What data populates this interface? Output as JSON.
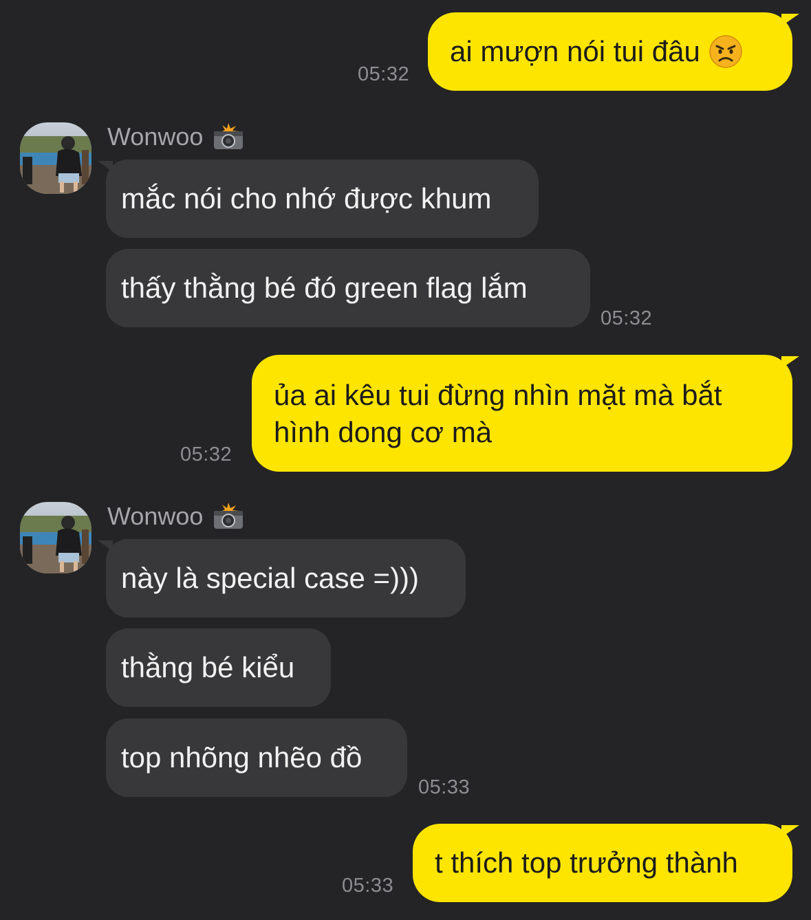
{
  "contact": {
    "name": "Wonwoo",
    "name_emoji_icon": "camera-flash-icon",
    "avatar_icon": "avatar-photo-icon"
  },
  "messages": [
    {
      "from": "me",
      "text": "ai mượn nói tui đâu",
      "emoji_icon": "angry-face-icon",
      "time": "05:32"
    },
    {
      "from": "them",
      "text": "mắc nói cho nhớ được khum",
      "time": ""
    },
    {
      "from": "them",
      "text": "thấy thằng bé đó green flag lắm",
      "time": "05:32"
    },
    {
      "from": "me",
      "text": "ủa ai kêu tui đừng nhìn mặt mà bắt hình dong cơ mà",
      "time": "05:32"
    },
    {
      "from": "them",
      "text": "này là special case =)))",
      "time": ""
    },
    {
      "from": "them",
      "text": "thằng bé kiểu",
      "time": ""
    },
    {
      "from": "them",
      "text": "top nhõng nhẽo đồ",
      "time": "05:33"
    },
    {
      "from": "me",
      "text": "t thích top trưởng thành",
      "time": "05:33"
    }
  ],
  "colors": {
    "background": "#242426",
    "my_bubble": "#fde500",
    "their_bubble": "#38383a",
    "timestamp": "#8e8e92"
  }
}
